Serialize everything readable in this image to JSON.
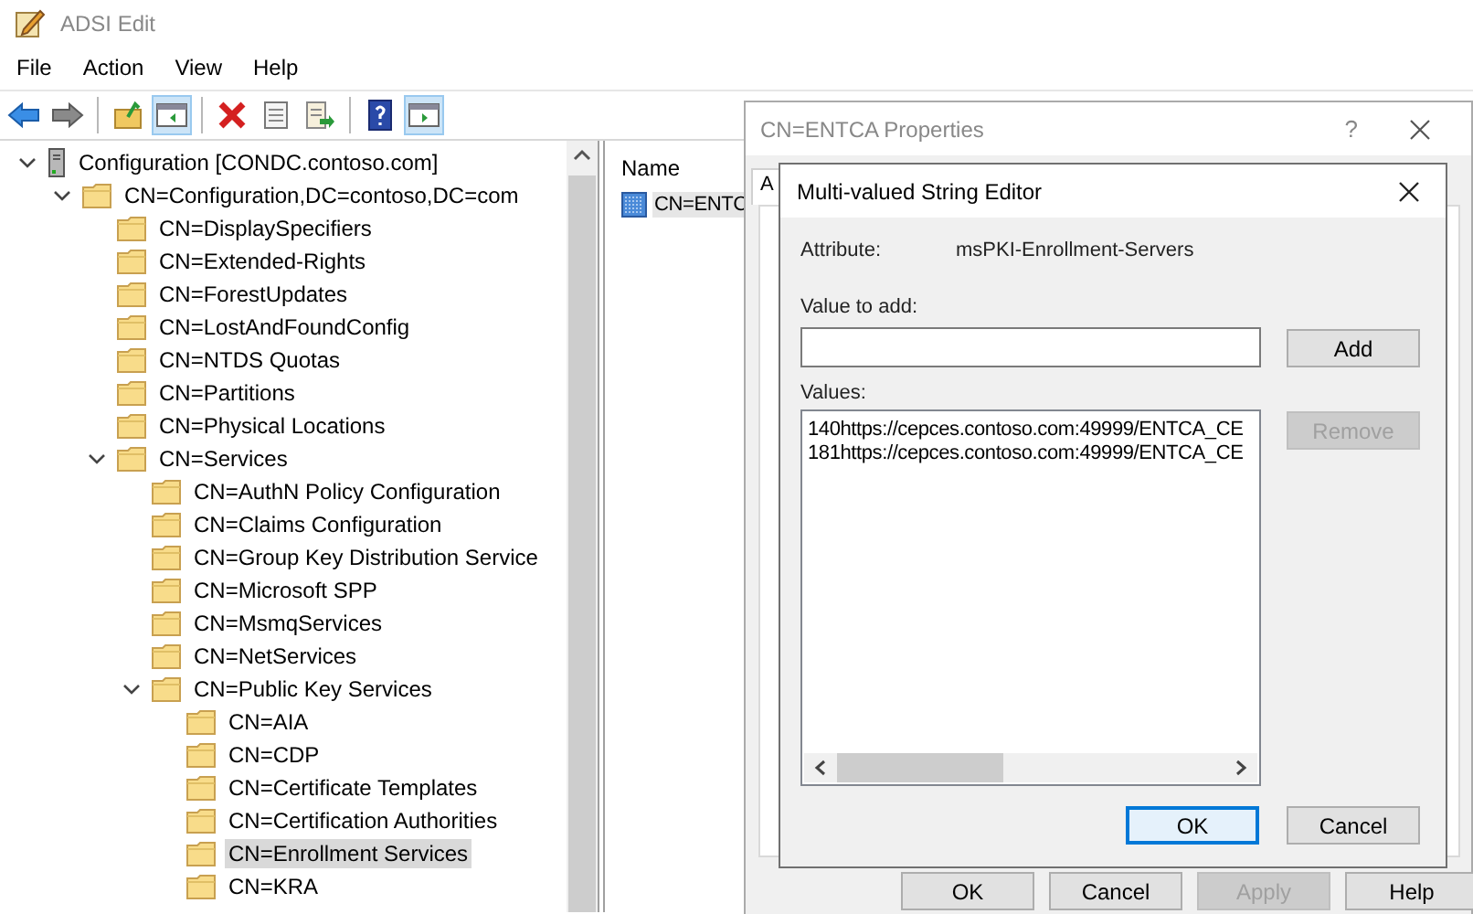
{
  "window": {
    "title": "ADSI Edit"
  },
  "menu": [
    "File",
    "Action",
    "View",
    "Help"
  ],
  "toolbar": [
    [
      {
        "kind": "back",
        "pressed": false
      },
      {
        "kind": "forward",
        "pressed": false
      }
    ],
    [
      {
        "kind": "up",
        "pressed": false
      },
      {
        "kind": "tree-pane",
        "pressed": true
      }
    ],
    [
      {
        "kind": "delete",
        "pressed": false
      },
      {
        "kind": "properties",
        "pressed": false
      },
      {
        "kind": "export",
        "pressed": false
      }
    ],
    [
      {
        "kind": "help",
        "pressed": false
      },
      {
        "kind": "action-pane",
        "pressed": true
      }
    ]
  ],
  "tree": [
    {
      "label": "Configuration [CONDC.contoso.com]",
      "kind": "server",
      "expanded": true,
      "selected": false,
      "children": [
        {
          "label": "CN=Configuration,DC=contoso,DC=com",
          "kind": "folder",
          "expanded": true,
          "selected": false,
          "children": [
            {
              "label": "CN=DisplaySpecifiers",
              "kind": "folder",
              "selected": false
            },
            {
              "label": "CN=Extended-Rights",
              "kind": "folder",
              "selected": false
            },
            {
              "label": "CN=ForestUpdates",
              "kind": "folder",
              "selected": false
            },
            {
              "label": "CN=LostAndFoundConfig",
              "kind": "folder",
              "selected": false
            },
            {
              "label": "CN=NTDS Quotas",
              "kind": "folder",
              "selected": false
            },
            {
              "label": "CN=Partitions",
              "kind": "folder",
              "selected": false
            },
            {
              "label": "CN=Physical Locations",
              "kind": "folder",
              "selected": false
            },
            {
              "label": "CN=Services",
              "kind": "folder",
              "expanded": true,
              "selected": false,
              "children": [
                {
                  "label": "CN=AuthN Policy Configuration",
                  "kind": "folder",
                  "selected": false
                },
                {
                  "label": "CN=Claims Configuration",
                  "kind": "folder",
                  "selected": false
                },
                {
                  "label": "CN=Group Key Distribution Service",
                  "kind": "folder",
                  "selected": false
                },
                {
                  "label": "CN=Microsoft SPP",
                  "kind": "folder",
                  "selected": false
                },
                {
                  "label": "CN=MsmqServices",
                  "kind": "folder",
                  "selected": false
                },
                {
                  "label": "CN=NetServices",
                  "kind": "folder",
                  "selected": false
                },
                {
                  "label": "CN=Public Key Services",
                  "kind": "folder",
                  "expanded": true,
                  "selected": false,
                  "children": [
                    {
                      "label": "CN=AIA",
                      "kind": "folder",
                      "selected": false
                    },
                    {
                      "label": "CN=CDP",
                      "kind": "folder",
                      "selected": false
                    },
                    {
                      "label": "CN=Certificate Templates",
                      "kind": "folder",
                      "selected": false
                    },
                    {
                      "label": "CN=Certification Authorities",
                      "kind": "folder",
                      "selected": false
                    },
                    {
                      "label": "CN=Enrollment Services",
                      "kind": "folder",
                      "selected": true
                    },
                    {
                      "label": "CN=KRA",
                      "kind": "folder",
                      "selected": false
                    }
                  ]
                }
              ]
            }
          ]
        }
      ]
    }
  ],
  "list": {
    "columns": [
      "Name"
    ],
    "items": [
      {
        "label": "CN=ENTC",
        "selected": true
      }
    ]
  },
  "properties_dialog": {
    "title": "CN=ENTCA Properties",
    "help_glyph": "?",
    "tabs": [
      {
        "label": "A",
        "selected": true
      }
    ],
    "buttons": [
      {
        "label": "OK",
        "disabled": false
      },
      {
        "label": "Cancel",
        "disabled": false
      },
      {
        "label": "Apply",
        "disabled": true
      },
      {
        "label": "Help",
        "disabled": false
      }
    ]
  },
  "string_editor": {
    "title": "Multi-valued String Editor",
    "attribute_label": "Attribute:",
    "attribute_value": "msPKI-Enrollment-Servers",
    "value_to_add_label": "Value to add:",
    "values_label": "Values:",
    "values": [
      {
        "text": "140https://cepces.contoso.com:49999/ENTCA_CE",
        "selected": false
      },
      {
        "text": "181https://cepces.contoso.com:49999/ENTCA_CE",
        "selected": false
      }
    ],
    "add_button": {
      "label": "Add",
      "disabled": false
    },
    "remove_button": {
      "label": "Remove",
      "disabled": true
    },
    "footer_buttons": [
      {
        "label": "OK",
        "default": true
      },
      {
        "label": "Cancel",
        "default": false
      }
    ]
  }
}
